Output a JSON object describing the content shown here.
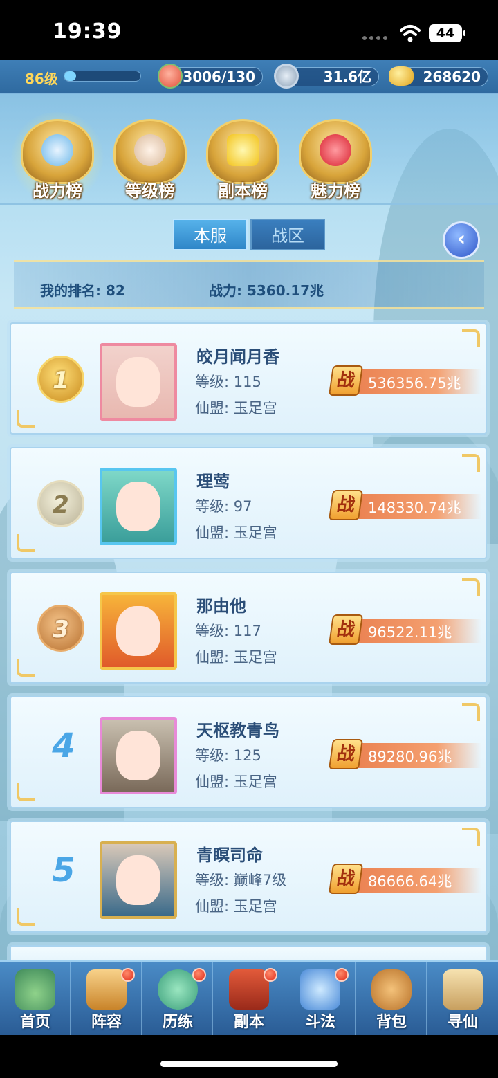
{
  "status_bar": {
    "time": "19:39",
    "battery": "44"
  },
  "resources": {
    "level": "86级",
    "xp_progress": 0.15,
    "stamina": "33006/130",
    "silver": "31.6亿",
    "gold": "268620"
  },
  "category_tabs": [
    {
      "label": "战力榜",
      "active": true
    },
    {
      "label": "等级榜",
      "active": false
    },
    {
      "label": "副本榜",
      "active": false
    },
    {
      "label": "魅力榜",
      "active": false
    }
  ],
  "scope_tabs": {
    "local": "本服",
    "zone": "战区"
  },
  "my_rank": {
    "rank_label": "我的排名: 82",
    "power_label": "战力: 5360.17兆"
  },
  "rankings": [
    {
      "rank": "1",
      "name": "皎月闻月香",
      "level": "等级: 115",
      "guild": "仙盟: 玉足宫",
      "power": "536356.75兆",
      "badge": "战"
    },
    {
      "rank": "2",
      "name": "理莺",
      "level": "等级: 97",
      "guild": "仙盟: 玉足宫",
      "power": "148330.74兆",
      "badge": "战"
    },
    {
      "rank": "3",
      "name": "那由他",
      "level": "等级: 117",
      "guild": "仙盟: 玉足宫",
      "power": "96522.11兆",
      "badge": "战"
    },
    {
      "rank": "4",
      "name": "天枢教青鸟",
      "level": "等级: 125",
      "guild": "仙盟: 玉足宫",
      "power": "89280.96兆",
      "badge": "战"
    },
    {
      "rank": "5",
      "name": "青瞑司命",
      "level": "等级: 巅峰7级",
      "guild": "仙盟: 玉足宫",
      "power": "86666.64兆",
      "badge": "战"
    }
  ],
  "bottom_nav": [
    {
      "label": "首页",
      "icon": "home-icon",
      "dot": false
    },
    {
      "label": "阵容",
      "icon": "lineup-icon",
      "dot": true
    },
    {
      "label": "历练",
      "icon": "training-icon",
      "dot": true
    },
    {
      "label": "副本",
      "icon": "dungeon-icon",
      "dot": true
    },
    {
      "label": "斗法",
      "icon": "battle-icon",
      "dot": true
    },
    {
      "label": "背包",
      "icon": "bag-icon",
      "dot": false
    },
    {
      "label": "寻仙",
      "icon": "scroll-icon",
      "dot": false
    }
  ],
  "colors": {
    "accent": "#2f86c8",
    "power_bar": "#e87a4a",
    "gold": "#f2cf6a"
  }
}
